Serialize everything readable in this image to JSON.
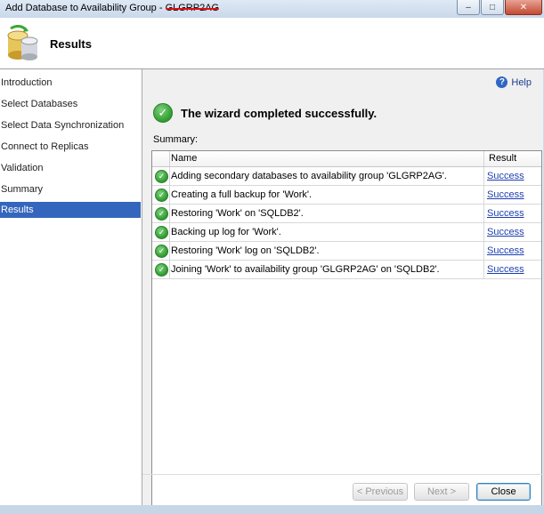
{
  "window": {
    "title_prefix": "Add Database to Availability Group - ",
    "title_redacted": "GLGRP2AG"
  },
  "header": {
    "title": "Results"
  },
  "nav": {
    "items": [
      {
        "label": "Introduction"
      },
      {
        "label": "Select Databases"
      },
      {
        "label": "Select Data Synchronization"
      },
      {
        "label": "Connect to Replicas"
      },
      {
        "label": "Validation"
      },
      {
        "label": "Summary"
      },
      {
        "label": "Results"
      }
    ],
    "active_index": 6
  },
  "main": {
    "help_label": "Help",
    "status_message": "The wizard completed successfully.",
    "summary_label": "Summary:",
    "columns": {
      "name": "Name",
      "result": "Result"
    },
    "rows": [
      {
        "name": "Adding secondary databases to availability group 'GLGRP2AG'.",
        "result": "Success"
      },
      {
        "name": "Creating a full backup for 'Work'.",
        "result": "Success"
      },
      {
        "name": "Restoring 'Work' on 'SQLDB2'.",
        "result": "Success"
      },
      {
        "name": "Backing up log for 'Work'.",
        "result": "Success"
      },
      {
        "name": "Restoring 'Work' log on 'SQLDB2'.",
        "result": "Success"
      },
      {
        "name": "Joining 'Work' to availability group 'GLGRP2AG' on 'SQLDB2'.",
        "result": "Success"
      }
    ]
  },
  "buttons": {
    "previous": "< Previous",
    "next": "Next >",
    "close": "Close"
  },
  "colors": {
    "nav_active": "#3466bd",
    "success_green": "#2e9c2e",
    "link_blue": "#1c3fb0"
  }
}
